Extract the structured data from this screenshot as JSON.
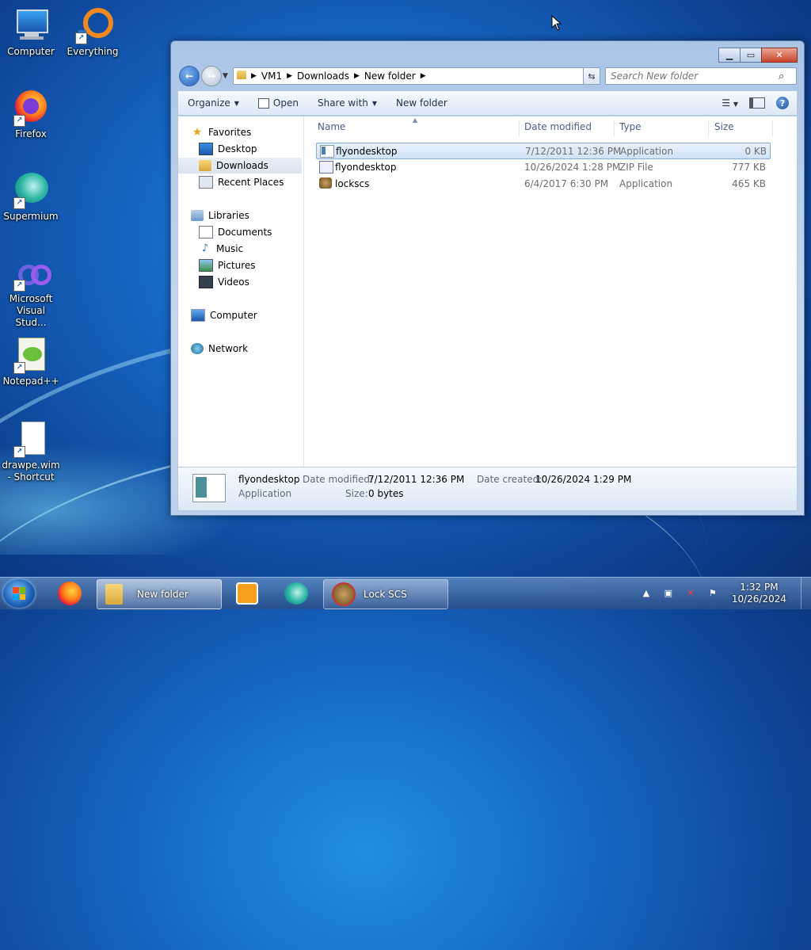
{
  "desktop": {
    "icons": [
      {
        "label": "Computer"
      },
      {
        "label": "Everything"
      },
      {
        "label": "Firefox"
      },
      {
        "label": "Supermium"
      },
      {
        "label": "Microsoft Visual Stud..."
      },
      {
        "label": "Notepad++"
      },
      {
        "label": "drawpe.wim - Shortcut"
      }
    ]
  },
  "window": {
    "breadcrumb": [
      "VM1",
      "Downloads",
      "New folder"
    ],
    "search_placeholder": "Search New folder",
    "toolbar": {
      "organize": "Organize",
      "open": "Open",
      "share_with": "Share with",
      "new_folder": "New folder"
    },
    "nav": {
      "favorites": "Favorites",
      "desktop": "Desktop",
      "downloads": "Downloads",
      "recent_places": "Recent Places",
      "libraries": "Libraries",
      "documents": "Documents",
      "music": "Music",
      "pictures": "Pictures",
      "videos": "Videos",
      "computer": "Computer",
      "network": "Network"
    },
    "columns": {
      "name": "Name",
      "date_modified": "Date modified",
      "type": "Type",
      "size": "Size"
    },
    "files": [
      {
        "name": "flyondesktop",
        "date": "7/12/2011 12:36 PM",
        "type": "Application",
        "size": "0 KB"
      },
      {
        "name": "flyondesktop",
        "date": "10/26/2024 1:28 PM",
        "type": "ZIP File",
        "size": "777 KB"
      },
      {
        "name": "lockscs",
        "date": "6/4/2017 6:30 PM",
        "type": "Application",
        "size": "465 KB"
      }
    ],
    "details": {
      "name": "flyondesktop",
      "type": "Application",
      "date_modified_label": "Date modified:",
      "date_modified": "7/12/2011 12:36 PM",
      "date_created_label": "Date created:",
      "date_created": "10/26/2024 1:29 PM",
      "size_label": "Size:",
      "size": "0 bytes"
    }
  },
  "taskbar": {
    "explorer_label": "New folder",
    "lockscs_label": "Lock SCS",
    "time": "1:32 PM",
    "date": "10/26/2024"
  },
  "colors": {
    "accent": "#1f5fbf",
    "selection": "#cfe2f7"
  }
}
